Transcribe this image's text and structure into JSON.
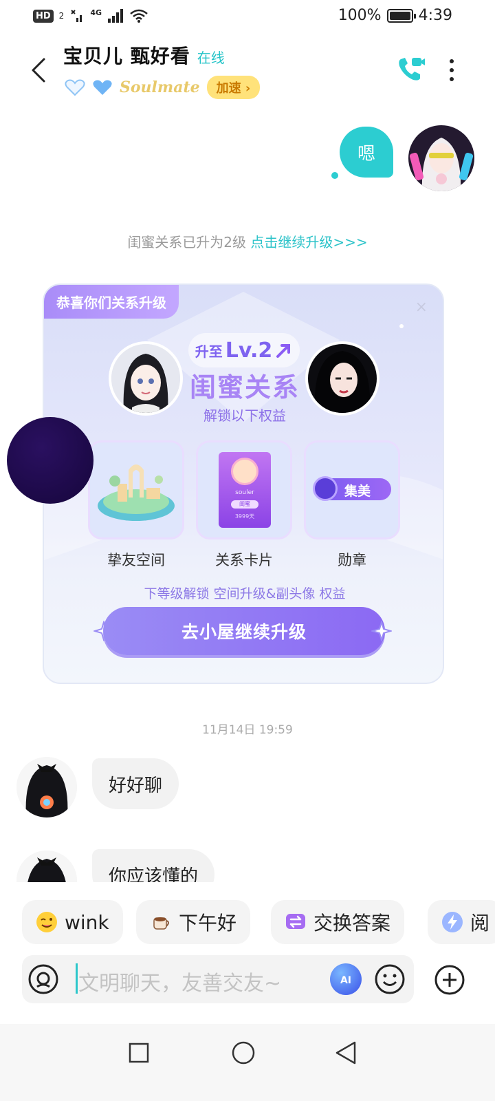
{
  "status_bar": {
    "hd": "HD",
    "hd_sub": "2",
    "net": "4G",
    "battery": "100%",
    "battery_level": 1.0,
    "time": "4:39"
  },
  "header": {
    "title": "宝贝儿  甄好看",
    "status": "在线",
    "badge": "Soulmate",
    "speed_label": "加速"
  },
  "outgoing": {
    "text": "嗯"
  },
  "system_message": {
    "text": "闺蜜关系已升为2级 ",
    "link": "点击继续升级>>>"
  },
  "card": {
    "ribbon": "恭喜你们关系升级",
    "close": "×",
    "level_prefix": "升至",
    "level": "Lv.2",
    "relation": "闺蜜关系",
    "unlock_text": "解锁以下权益",
    "perks": [
      {
        "label": "挚友空间"
      },
      {
        "label": "关系卡片",
        "card_name": "souler",
        "card_tag": "闺蜜",
        "card_days": "3999天"
      },
      {
        "label": "勋章",
        "badge_text": "集美"
      }
    ],
    "next_hint": "下等级解锁 空间升级&副头像 权益",
    "button": "去小屋继续升级"
  },
  "timestamp": "11月14日 19:59",
  "incoming": [
    {
      "text": "好好聊"
    },
    {
      "text": "你应该懂的"
    }
  ],
  "quick_replies": [
    {
      "label": "wink",
      "icon": "wink-emoji-icon"
    },
    {
      "label": "下午好",
      "icon": "coffee-icon"
    },
    {
      "label": "交换答案",
      "icon": "exchange-icon"
    },
    {
      "label": "阅",
      "icon": "lightning-icon"
    }
  ],
  "input": {
    "placeholder": "文明聊天，友善交友~"
  },
  "colors": {
    "accent": "#2ccdd1",
    "purple": "#8b69f3"
  }
}
